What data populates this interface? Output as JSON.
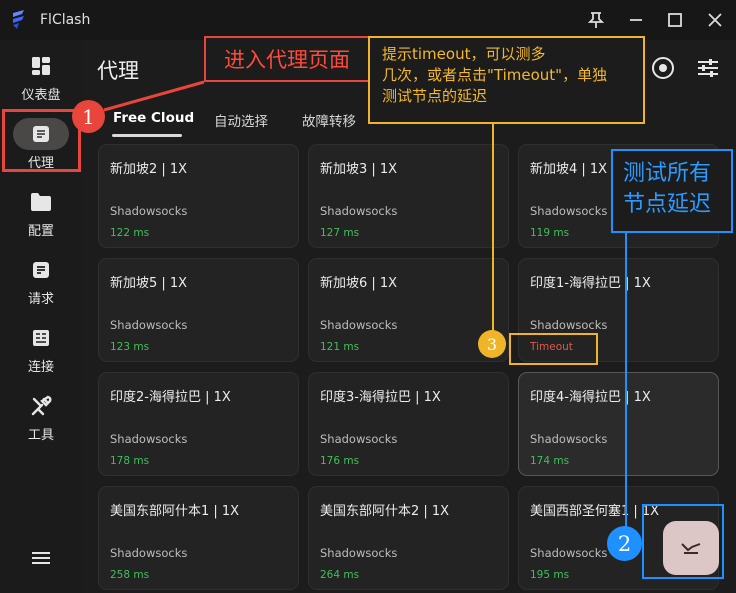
{
  "app": {
    "title": "FlClash",
    "accent": "#3e66ff"
  },
  "sidebar": {
    "items": [
      {
        "label": "仪表盘",
        "icon": "dashboard-icon"
      },
      {
        "label": "代理",
        "icon": "proxy-icon",
        "active": true
      },
      {
        "label": "配置",
        "icon": "folder-icon"
      },
      {
        "label": "请求",
        "icon": "request-icon"
      },
      {
        "label": "连接",
        "icon": "connection-icon"
      },
      {
        "label": "工具",
        "icon": "tools-icon"
      }
    ],
    "menu_icon": "menu-icon"
  },
  "header": {
    "title": "代理"
  },
  "tabs": [
    {
      "label": "Free Cloud",
      "active": true
    },
    {
      "label": "自动选择"
    },
    {
      "label": "故障转移"
    }
  ],
  "proxies": [
    {
      "name": "新加坡2 | 1X",
      "type": "Shadowsocks",
      "delay": "122 ms"
    },
    {
      "name": "新加坡3 | 1X",
      "type": "Shadowsocks",
      "delay": "127 ms"
    },
    {
      "name": "新加坡4 | 1X",
      "type": "Shadowsocks",
      "delay": "119 ms"
    },
    {
      "name": "新加坡5 | 1X",
      "type": "Shadowsocks",
      "delay": "123 ms"
    },
    {
      "name": "新加坡6 | 1X",
      "type": "Shadowsocks",
      "delay": "121 ms"
    },
    {
      "name": "印度1-海得拉巴 | 1X",
      "type": "Shadowsocks",
      "delay": "Timeout",
      "timeout": true
    },
    {
      "name": "印度2-海得拉巴 | 1X",
      "type": "Shadowsocks",
      "delay": "178 ms"
    },
    {
      "name": "印度3-海得拉巴 | 1X",
      "type": "Shadowsocks",
      "delay": "176 ms"
    },
    {
      "name": "印度4-海得拉巴 | 1X",
      "type": "Shadowsocks",
      "delay": "174 ms",
      "selected": true
    },
    {
      "name": "美国东部阿什本1 | 1X",
      "type": "Shadowsocks",
      "delay": "258 ms"
    },
    {
      "name": "美国东部阿什本2 | 1X",
      "type": "Shadowsocks",
      "delay": "264 ms"
    },
    {
      "name": "美国西部圣何塞1 | 1X",
      "type": "Shadowsocks",
      "delay": "195 ms"
    }
  ],
  "annotations": {
    "step1_label": "进入代理页面",
    "step2_label_line1": "测试所有",
    "step2_label_line2": "节点延迟",
    "step3_label_line1": "提示timeout，可以测多",
    "step3_label_line2": "几次，或者点击\"Timeout\"，单独",
    "step3_label_line3": "测试节点的延迟",
    "badge1": "1",
    "badge2": "2",
    "badge3": "3",
    "colors": {
      "red": "#e8453c",
      "blue": "#1e90ff",
      "orange": "#f0b429"
    }
  }
}
